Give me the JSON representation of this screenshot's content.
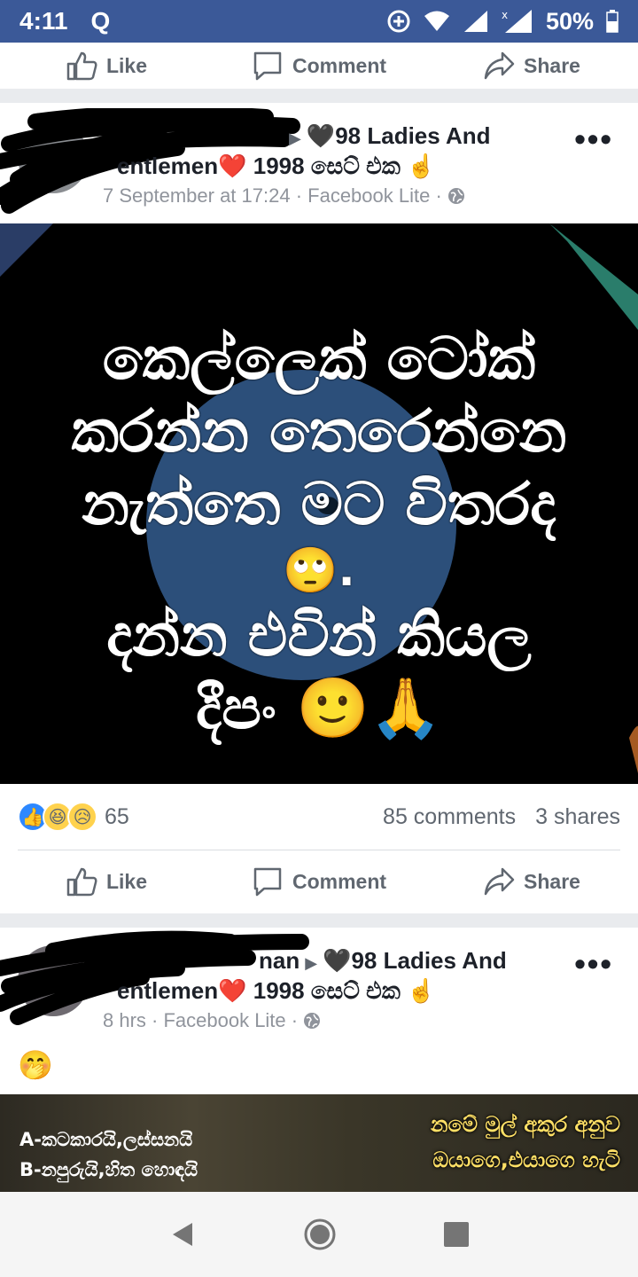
{
  "status_bar": {
    "time": "4:11",
    "notification": "Q",
    "battery": "50%"
  },
  "actions": {
    "like": "Like",
    "comment": "Comment",
    "share": "Share"
  },
  "post1": {
    "title_visible": "98 Ladies And",
    "title_line2": "entlemen",
    "title_suffix": "1998 සෙට් එක",
    "meta": "7 September at 17:24 · Facebook Lite ·",
    "image_text": [
      "කෙල්ලෙක් ටෝක්",
      "කරන්න තෙරෙන්නෙ",
      "නැත්තෙ මට විතරද",
      "🙄.",
      "දන්න එවින් කියල",
      "දීපං 🙂🙏"
    ],
    "reaction_count": "65",
    "comments": "85 comments",
    "shares": "3 shares"
  },
  "post2": {
    "title_visible": "nan",
    "title_group": "98 Ladies And",
    "title_line2": "entlemen",
    "title_suffix": "1998 සෙට් එක",
    "meta": "8 hrs · Facebook Lite ·",
    "body_emoji": "🤭",
    "image_left_lines": [
      "A-කටකාරයි,ලස්සනයි",
      "B-නපුරුයි,හිත හොඳයි"
    ],
    "image_right_lines": [
      "නමේ මුල් අකුර අනුව",
      "ඔයාගෙ,එයාගෙ හැටි"
    ]
  },
  "colors": {
    "facebook_blue": "#3b5998",
    "heart": "#e0245e",
    "meta_gray": "#90949c"
  },
  "icons": [
    "like-icon",
    "comment-icon",
    "share-icon",
    "globe-icon",
    "more-icon",
    "back-icon",
    "home-icon",
    "recents-icon",
    "wifi-icon",
    "signal-icon",
    "battery-icon",
    "data-saver-icon"
  ]
}
